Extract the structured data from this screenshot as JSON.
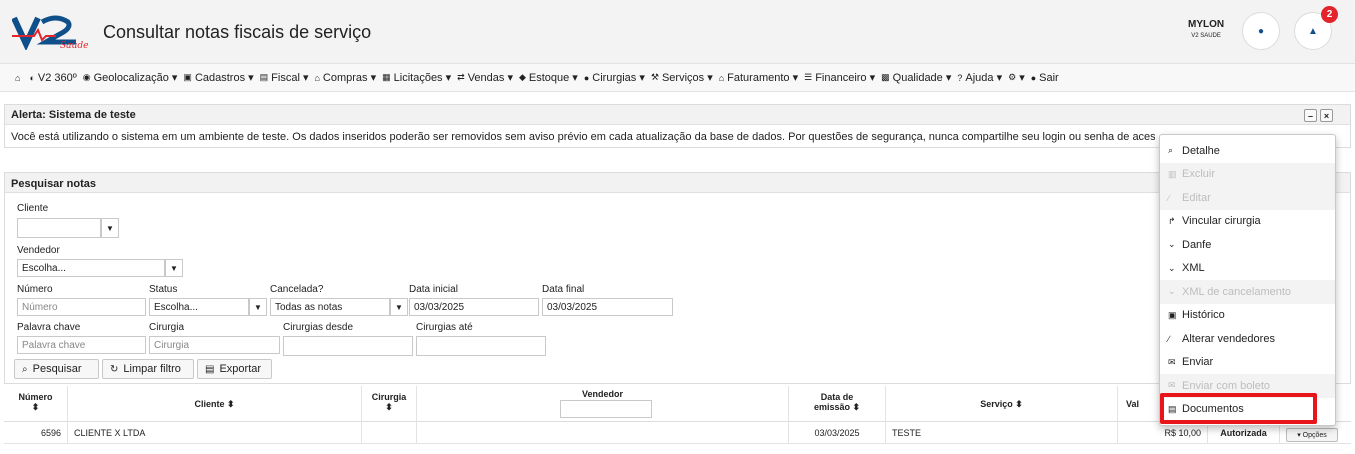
{
  "header": {
    "title": "Consultar notas fiscais de serviço",
    "logo_text": "V2 Saúde",
    "user_name": "MYLON",
    "user_sub": "V2 SAUDE",
    "notification_count": "2"
  },
  "nav": [
    {
      "icon": "home-icon",
      "glyph": "⌂",
      "label": ""
    },
    {
      "icon": "globe-icon",
      "glyph": "◐",
      "label": "V2 360º"
    },
    {
      "icon": "location-icon",
      "glyph": "◉",
      "label": "Geolocalização ▾"
    },
    {
      "icon": "truck-icon",
      "glyph": "▣",
      "label": "Cadastros ▾"
    },
    {
      "icon": "money-icon",
      "glyph": "▤",
      "label": "Fiscal ▾"
    },
    {
      "icon": "bank-icon",
      "glyph": "⌂",
      "label": "Compras ▾"
    },
    {
      "icon": "building-icon",
      "glyph": "▦",
      "label": "Licitações ▾"
    },
    {
      "icon": "exchange-icon",
      "glyph": "⇄",
      "label": "Vendas ▾"
    },
    {
      "icon": "tag-icon",
      "glyph": "◆",
      "label": "Estoque ▾"
    },
    {
      "icon": "plus-circle-icon",
      "glyph": "●",
      "label": "Cirurgias ▾"
    },
    {
      "icon": "wrench-icon",
      "glyph": "⚒",
      "label": "Serviços ▾"
    },
    {
      "icon": "bank-icon",
      "glyph": "⌂",
      "label": "Faturamento ▾"
    },
    {
      "icon": "list-icon",
      "glyph": "☰",
      "label": "Financeiro ▾"
    },
    {
      "icon": "quality-icon",
      "glyph": "▩",
      "label": "Qualidade ▾"
    },
    {
      "icon": "question-icon",
      "glyph": "?",
      "label": "Ajuda ▾"
    },
    {
      "icon": "gear-icon",
      "glyph": "⚙",
      "label": "▾"
    },
    {
      "icon": "power-icon",
      "glyph": "●",
      "label": "Sair"
    }
  ],
  "alert": {
    "title": "Alerta: Sistema de teste",
    "message": "Você está utilizando o sistema em um ambiente de teste. Os dados inseridos poderão ser removidos sem aviso prévio em cada atualização da base de dados. Por questões de segurança, nunca compartilhe seu login ou senha de acesso."
  },
  "search": {
    "title": "Pesquisar notas",
    "cliente_label": "Cliente",
    "vendedor_label": "Vendedor",
    "vendedor_value": "Escolha...",
    "numero_label": "Número",
    "numero_placeholder": "Número",
    "status_label": "Status",
    "status_value": "Escolha...",
    "cancelada_label": "Cancelada?",
    "cancelada_value": "Todas as notas",
    "data_inicial_label": "Data inicial",
    "data_inicial_value": "03/03/2025",
    "data_final_label": "Data final",
    "data_final_value": "03/03/2025",
    "palavra_label": "Palavra chave",
    "palavra_placeholder": "Palavra chave",
    "cirurgia_label": "Cirurgia",
    "cirurgia_placeholder": "Cirurgia",
    "cirurgias_desde_label": "Cirurgias desde",
    "cirurgias_ate_label": "Cirurgias até",
    "btn_pesquisar": "Pesquisar",
    "btn_limpar": "Limpar filtro",
    "btn_exportar": "Exportar"
  },
  "table": {
    "headers": {
      "numero": "Número",
      "cliente": "Cliente",
      "cirurgia": "Cirurgia",
      "vendedor": "Vendedor",
      "data_emissao_1": "Data de",
      "data_emissao_2": "emissão",
      "servico": "Serviço",
      "valor": "Val"
    },
    "sort_glyph": "⬍",
    "row": {
      "numero": "6596",
      "cliente": "CLIENTE X LTDA",
      "data": "03/03/2025",
      "servico": "TESTE",
      "valor": "R$ 10,00",
      "status": "Autorizada",
      "opcoes": "▾ Opções"
    }
  },
  "dropdown": [
    {
      "label": "Detalhe",
      "icon": "search-icon",
      "glyph": "⌕",
      "disabled": false
    },
    {
      "label": "Excluir",
      "icon": "trash-icon",
      "glyph": "▥",
      "disabled": true
    },
    {
      "label": "Editar",
      "icon": "pencil-icon",
      "glyph": "∕",
      "disabled": true
    },
    {
      "label": "Vincular cirurgia",
      "icon": "share-icon",
      "glyph": "↱",
      "disabled": false
    },
    {
      "label": "Danfe",
      "icon": "chevron-down-icon",
      "glyph": "⌄",
      "disabled": false
    },
    {
      "label": "XML",
      "icon": "chevron-down-icon",
      "glyph": "⌄",
      "disabled": false
    },
    {
      "label": "XML de cancelamento",
      "icon": "chevron-down-icon",
      "glyph": "⌄",
      "disabled": true
    },
    {
      "label": "Histórico",
      "icon": "history-icon",
      "glyph": "▣",
      "disabled": false
    },
    {
      "label": "Alterar vendedores",
      "icon": "pencil-icon",
      "glyph": "∕",
      "disabled": false
    },
    {
      "label": "Enviar",
      "icon": "envelope-icon",
      "glyph": "✉",
      "disabled": false
    },
    {
      "label": "Enviar com boleto",
      "icon": "envelope-icon",
      "glyph": "✉",
      "disabled": true
    },
    {
      "label": "Documentos",
      "icon": "document-icon",
      "glyph": "▤",
      "disabled": false
    }
  ],
  "colors": {
    "brand_blue": "#0f4f8a",
    "badge_red": "#e3242b",
    "highlight_red": "#e8151a"
  }
}
